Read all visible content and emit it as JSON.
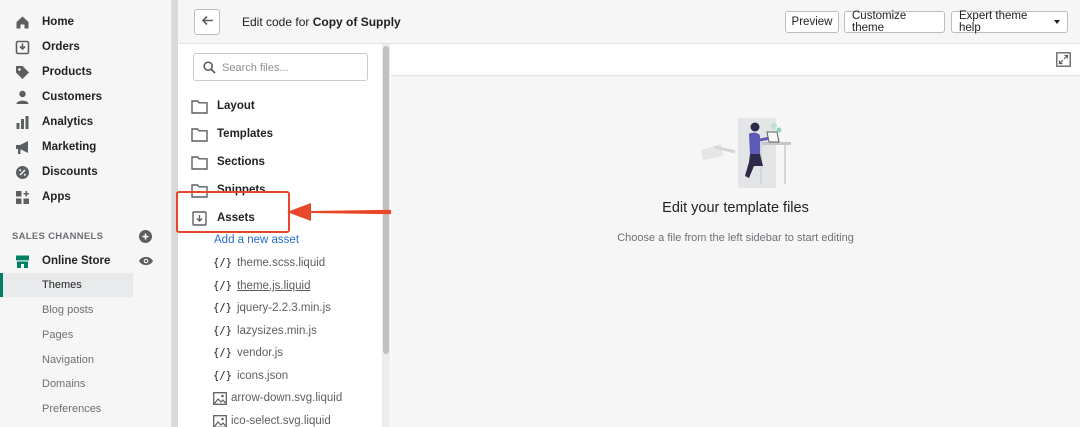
{
  "admin_nav": {
    "items": [
      {
        "label": "Home",
        "icon": "home-icon"
      },
      {
        "label": "Orders",
        "icon": "orders-icon"
      },
      {
        "label": "Products",
        "icon": "tag-icon"
      },
      {
        "label": "Customers",
        "icon": "person-icon"
      },
      {
        "label": "Analytics",
        "icon": "bar-chart-icon"
      },
      {
        "label": "Marketing",
        "icon": "megaphone-icon"
      },
      {
        "label": "Discounts",
        "icon": "discount-icon"
      },
      {
        "label": "Apps",
        "icon": "apps-icon"
      }
    ],
    "sales_channels_label": "SALES CHANNELS",
    "online_store": {
      "label": "Online Store",
      "icon": "store-icon"
    },
    "sub_items": [
      "Themes",
      "Blog posts",
      "Pages",
      "Navigation",
      "Domains",
      "Preferences"
    ],
    "active_sub_item": "Themes"
  },
  "topbar": {
    "title_prefix": "Edit code for",
    "theme_name": "Copy of Supply",
    "preview_label": "Preview",
    "customize_label": "Customize theme",
    "expert_help_label": "Expert theme help"
  },
  "file_sidebar": {
    "search_placeholder": "Search files...",
    "folders": [
      "Layout",
      "Templates",
      "Sections",
      "Snippets",
      "Assets"
    ],
    "add_asset_label": "Add a new asset",
    "files": [
      {
        "name": "theme.scss.liquid",
        "icon": "code-icon",
        "glyph": "{/}"
      },
      {
        "name": "theme.js.liquid",
        "icon": "code-icon",
        "glyph": "{/}"
      },
      {
        "name": "jquery-2.2.3.min.js",
        "icon": "code-icon",
        "glyph": "{/}"
      },
      {
        "name": "lazysizes.min.js",
        "icon": "code-icon",
        "glyph": "{/}"
      },
      {
        "name": "vendor.js",
        "icon": "code-icon",
        "glyph": "{/}"
      },
      {
        "name": "icons.json",
        "icon": "code-icon",
        "glyph": "{/}"
      },
      {
        "name": "arrow-down.svg.liquid",
        "icon": "image-icon"
      },
      {
        "name": "ico-select.svg.liquid",
        "icon": "image-icon"
      }
    ]
  },
  "editor": {
    "empty_title": "Edit your template files",
    "empty_subtitle": "Choose a file from the left sidebar to start editing"
  },
  "colors": {
    "accent_green": "#008060",
    "link_blue": "#2c6ecb",
    "annotation_red": "#e8472a"
  }
}
